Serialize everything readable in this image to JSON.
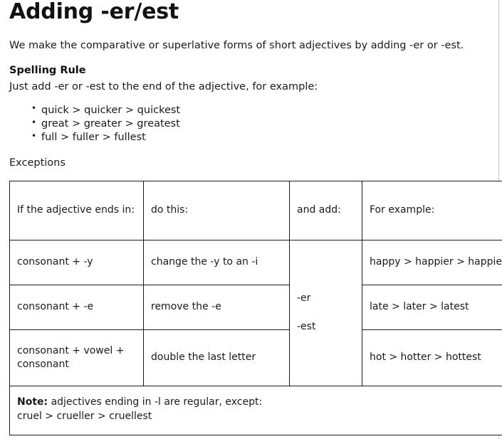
{
  "document": {
    "title": "Adding -er/est",
    "intro": "We make the comparative or superlative forms of short adjectives by adding -er or -est.",
    "spelling_rule_heading": "Spelling Rule",
    "spelling_rule_text": "Just add -er or -est to the end of the adjective, for example:",
    "examples": [
      "quick > quicker > quickest",
      "great > greater > greatest",
      "full > fuller > fullest"
    ],
    "exceptions_label": "Exceptions"
  },
  "table": {
    "headers": {
      "col1": "If the adjective ends in:",
      "col2": "do this:",
      "col3": "and add:",
      "col4": "For example:"
    },
    "add_suffixes": {
      "first": "-er",
      "second": "-est"
    },
    "rows": [
      {
        "condition": "consonant + -y",
        "action": "change the -y to an -i",
        "example": "happy > happier > happiest"
      },
      {
        "condition": "consonant + -e",
        "action": "remove the -e",
        "example": "late > later > latest"
      },
      {
        "condition": "consonant + vowel + consonant",
        "action": "double the last letter",
        "example": "hot > hotter > hottest"
      }
    ],
    "note": {
      "label": "Note:",
      "text": " adjectives ending in -l are regular, except:",
      "example": "cruel > crueller > cruellest"
    }
  },
  "colors": {
    "text": "#1a1a1a",
    "border": "#1c1c1c",
    "background": "#ffffff",
    "edge_rule": "#c8c8c8"
  }
}
